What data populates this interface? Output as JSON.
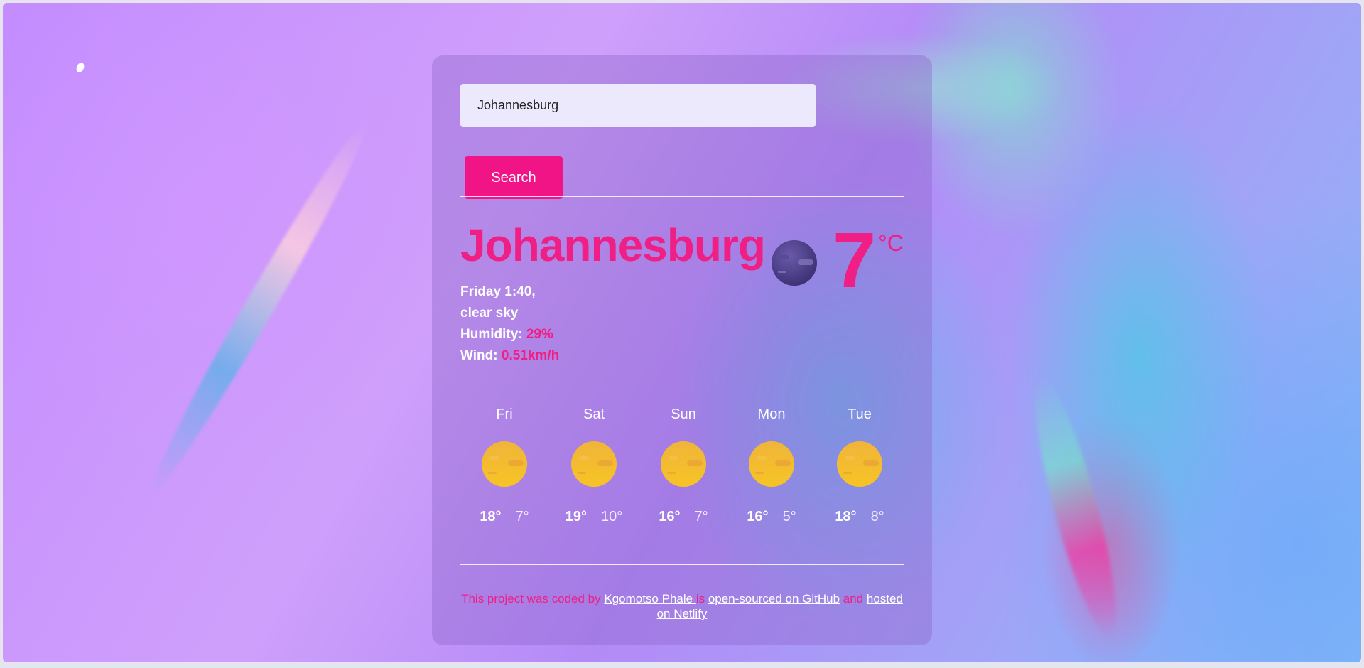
{
  "search": {
    "value": "Johannesburg",
    "button_label": "Search"
  },
  "current": {
    "city": "Johannesburg",
    "datetime": "Friday 1:40,",
    "description": "clear sky",
    "humidity_label": "Humidity:",
    "humidity_value": "29%",
    "wind_label": "Wind:",
    "wind_value": "0.51km/h",
    "temperature": "7",
    "unit": "°C",
    "icon": "clear-night-icon"
  },
  "forecast": [
    {
      "day": "Fri",
      "high": "18°",
      "low": "7°",
      "icon": "sun-icon"
    },
    {
      "day": "Sat",
      "high": "19°",
      "low": "10°",
      "icon": "sun-icon"
    },
    {
      "day": "Sun",
      "high": "16°",
      "low": "7°",
      "icon": "sun-icon"
    },
    {
      "day": "Mon",
      "high": "16°",
      "low": "5°",
      "icon": "sun-icon"
    },
    {
      "day": "Tue",
      "high": "18°",
      "low": "8°",
      "icon": "sun-icon"
    }
  ],
  "footer": {
    "prefix": "This project was coded by ",
    "author_link": "Kgomotso Phale ",
    "middle": " is ",
    "github_link": "open-sourced on GitHub",
    "and": " and ",
    "netlify_link": "hosted on Netlify"
  },
  "colors": {
    "accent": "#ef1f86",
    "button": "#f01487",
    "input_bg": "#ebe9fb"
  }
}
